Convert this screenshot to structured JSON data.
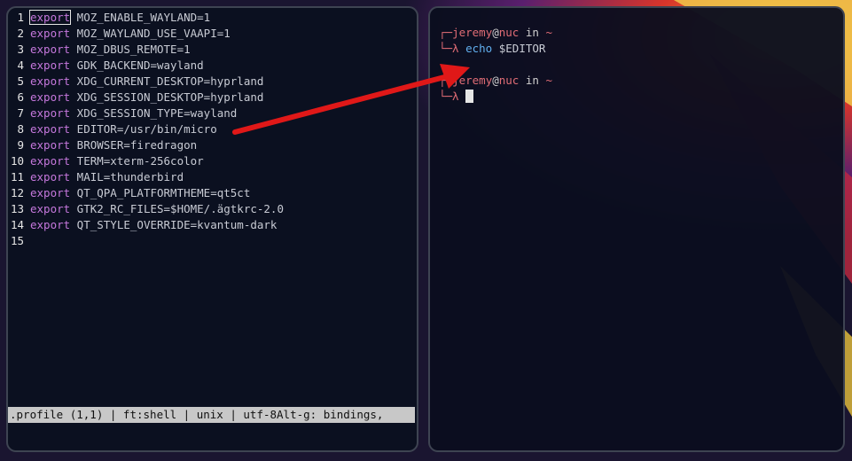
{
  "editor": {
    "lines": [
      {
        "num": "1",
        "kw": "export",
        "rest": " MOZ_ENABLE_WAYLAND=1"
      },
      {
        "num": "2",
        "kw": "export",
        "rest": " MOZ_WAYLAND_USE_VAAPI=1"
      },
      {
        "num": "3",
        "kw": "export",
        "rest": " MOZ_DBUS_REMOTE=1"
      },
      {
        "num": "4",
        "kw": "export",
        "rest": " GDK_BACKEND=wayland"
      },
      {
        "num": "5",
        "kw": "export",
        "rest": " XDG_CURRENT_DESKTOP=hyprland"
      },
      {
        "num": "6",
        "kw": "export",
        "rest": " XDG_SESSION_DESKTOP=hyprland"
      },
      {
        "num": "7",
        "kw": "export",
        "rest": " XDG_SESSION_TYPE=wayland"
      },
      {
        "num": "8",
        "kw": "export",
        "rest": " EDITOR=/usr/bin/micro"
      },
      {
        "num": "9",
        "kw": "export",
        "rest": " BROWSER=firedragon"
      },
      {
        "num": "10",
        "kw": "export",
        "rest": " TERM=xterm-256color"
      },
      {
        "num": "11",
        "kw": "export",
        "rest": " MAIL=thunderbird"
      },
      {
        "num": "12",
        "kw": "export",
        "rest": " QT_QPA_PLATFORMTHEME=qt5ct"
      },
      {
        "num": "13",
        "kw": "export",
        "rest": " GTK2_RC_FILES=$HOME/.ägtkrc-2.0"
      },
      {
        "num": "14",
        "kw": "export",
        "rest": " QT_STYLE_OVERRIDE=kvantum-dark"
      },
      {
        "num": "15",
        "kw": "",
        "rest": ""
      }
    ],
    "status_bar": ".profile (1,1) | ft:shell | unix | utf-8Alt-g: bindings,"
  },
  "terminal": {
    "prompt1": {
      "bracket": "┌─",
      "user": "jeremy",
      "at": "@",
      "host": "nuc",
      "in": " in ",
      "path": "~"
    },
    "command1": {
      "lambda": "└─λ ",
      "cmd": "echo",
      "arg": " $EDITOR"
    },
    "prompt2": {
      "bracket": "┌─",
      "user": "jeremy",
      "at": "@",
      "host": "nuc",
      "in": " in ",
      "path": "~"
    },
    "command2": {
      "lambda": "└─λ "
    }
  },
  "colors": {
    "accent_red": "#e06c75",
    "keyword": "#c678dd",
    "command": "#61afef",
    "arrow": "#e01818"
  },
  "annotation": {
    "type": "arrow",
    "from": "editor line 8 (EDITOR)",
    "to": "terminal echo $EDITOR"
  }
}
